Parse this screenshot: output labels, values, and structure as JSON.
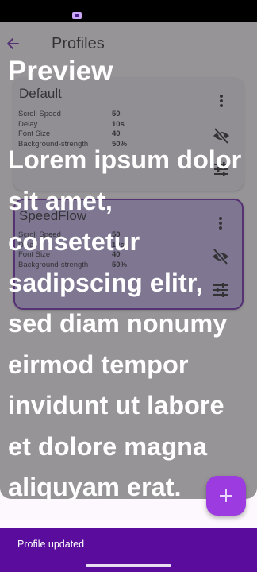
{
  "status_bar": {
    "app_icon": "app-icon"
  },
  "header": {
    "title": "Profiles",
    "back_icon": "arrow-back-icon"
  },
  "preview": {
    "title": "Preview",
    "text": "Lorem ipsum dolor sit amet, consetetur sadipscing elitr, sed diam nonumy eirmod tempor invidunt ut labore et dolore magna aliquyam erat."
  },
  "profiles": [
    {
      "name": "Default",
      "selected": false,
      "properties": [
        {
          "label": "Scroll Speed",
          "value": "50"
        },
        {
          "label": "Delay",
          "value": "10s"
        },
        {
          "label": "Font Size",
          "value": "40"
        },
        {
          "label": "Background-strength",
          "value": "50%"
        }
      ]
    },
    {
      "name": "SpeedFlow",
      "selected": true,
      "properties": [
        {
          "label": "Scroll Speed",
          "value": "50"
        },
        {
          "label": "Delay",
          "value": "10s"
        },
        {
          "label": "Font Size",
          "value": "40"
        },
        {
          "label": "Background-strength",
          "value": "50%"
        }
      ]
    }
  ],
  "icons": {
    "menu": "more-vert-icon",
    "visibility": "visibility-off-icon",
    "tune": "tune-icon",
    "add": "add-icon"
  },
  "snackbar": {
    "message": "Profile updated"
  },
  "colors": {
    "accent": "#6a1ab0",
    "fab": "#9b3be0",
    "snackbar": "#5a0d9c",
    "selected_card": "#c9b5f4",
    "card": "#f3edf7",
    "background": "#fdf8fd"
  }
}
